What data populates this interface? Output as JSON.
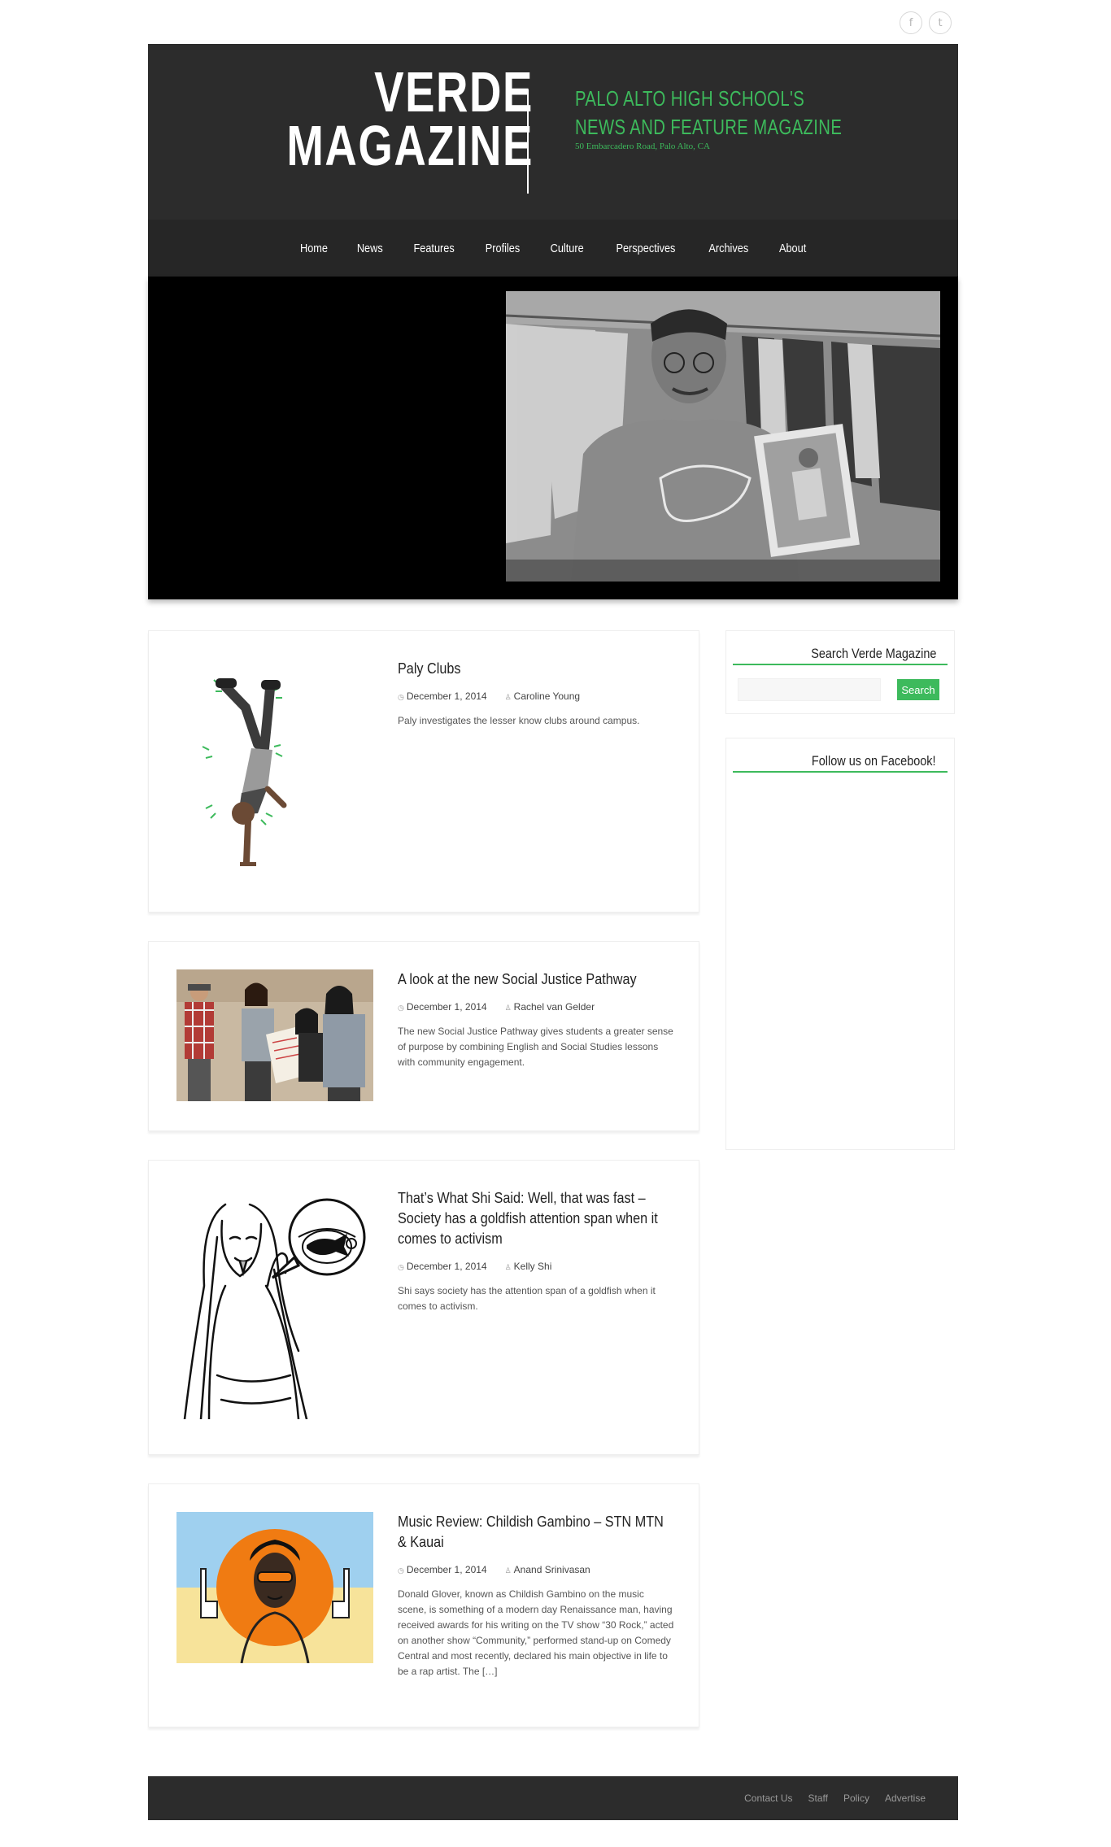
{
  "social": {
    "facebook_icon": "f",
    "twitter_icon": "t"
  },
  "header": {
    "logo_line1": "VERDE",
    "logo_line2": "MAGAZINE",
    "tagline_line1": "PALO ALTO HIGH SCHOOL'S",
    "tagline_line2": "NEWS AND FEATURE MAGAZINE",
    "address": "50 Embarcadero Road, Palo Alto, CA"
  },
  "nav": {
    "items": [
      {
        "label": "Home"
      },
      {
        "label": "News"
      },
      {
        "label": "Features"
      },
      {
        "label": "Profiles"
      },
      {
        "label": "Culture"
      },
      {
        "label": "Perspectives"
      },
      {
        "label": "Archives"
      },
      {
        "label": "About"
      }
    ]
  },
  "posts": [
    {
      "title": "Paly Clubs",
      "date": "December 1, 2014",
      "author": "Caroline Young",
      "excerpt": "Paly investigates the lesser know clubs around campus."
    },
    {
      "title": "A look at the new Social Justice Pathway",
      "date": "December 1, 2014",
      "author": "Rachel van Gelder",
      "excerpt": "The new Social Justice Pathway gives students a greater sense of purpose by combining English and Social Studies lessons with community engagement."
    },
    {
      "title": "That’s What Shi Said: Well, that was fast – Society has a goldfish attention span when it comes to activism",
      "date": "December 1, 2014",
      "author": "Kelly Shi",
      "excerpt": "Shi says society has the attention span of a goldfish when it comes to activism."
    },
    {
      "title": "Music Review: Childish Gambino – STN MTN & Kauai",
      "date": "December 1, 2014",
      "author": "Anand Srinivasan",
      "excerpt": "Donald Glover, known as Childish Gambino on the music scene, is something of a modern day Renaissance man, having received awards for his writing on the TV show “30 Rock,” acted on another show “Community,” performed stand-up on Comedy Central and most recently, declared his main objective in life to be a rap artist. The […]"
    }
  ],
  "sidebar": {
    "search_title": "Search Verde Magazine",
    "search_button": "Search",
    "facebook_title": "Follow us on Facebook!"
  },
  "footer": {
    "links": [
      {
        "label": "Contact Us"
      },
      {
        "label": "Staff"
      },
      {
        "label": "Policy"
      },
      {
        "label": "Advertise"
      }
    ]
  },
  "colors": {
    "accent": "#3dba5c",
    "header_bg": "#2c2c2c",
    "nav_bg": "#262626"
  }
}
